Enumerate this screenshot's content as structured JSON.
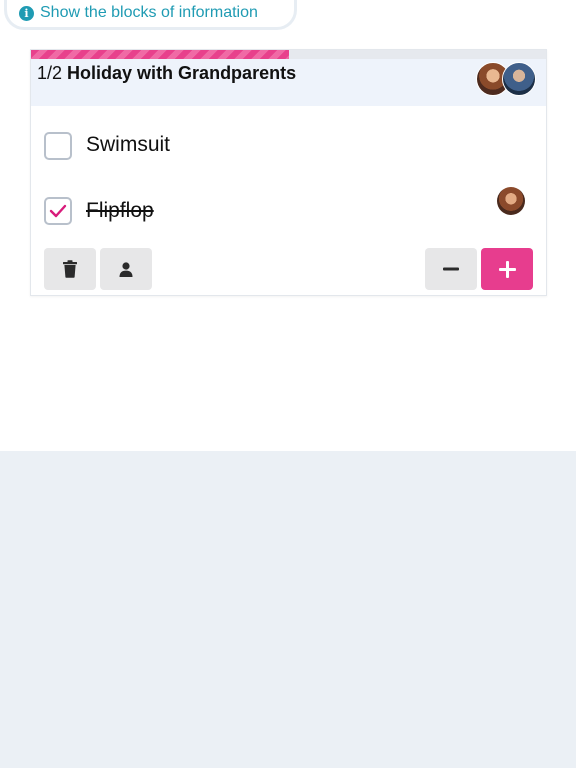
{
  "info_bar": {
    "icon": "info-icon",
    "label": "Show the blocks of information",
    "color": "#1f9bb3"
  },
  "card": {
    "progress": {
      "done": 1,
      "total": 2,
      "fraction": 0.5,
      "color": "#e8418c"
    },
    "count_label": "1/2",
    "title": "Holiday with Grandparents",
    "header_avatars": [
      "avatar",
      "avatar"
    ],
    "items": [
      {
        "label": "Swimsuit",
        "checked": false
      },
      {
        "label": "Flipflop",
        "checked": true,
        "assignee": "avatar"
      }
    ],
    "actions_left": [
      {
        "icon": "trash-icon",
        "name": "delete"
      },
      {
        "icon": "person-icon",
        "name": "assign"
      }
    ],
    "actions_right": [
      {
        "icon": "minus-icon",
        "name": "decrease"
      },
      {
        "icon": "plus-icon",
        "name": "increase",
        "color": "#e73d8e"
      }
    ]
  },
  "colors": {
    "accent": "#e73d8e",
    "header_bg": "#eef3fb",
    "page_bg_bottom": "#ebf0f5"
  }
}
